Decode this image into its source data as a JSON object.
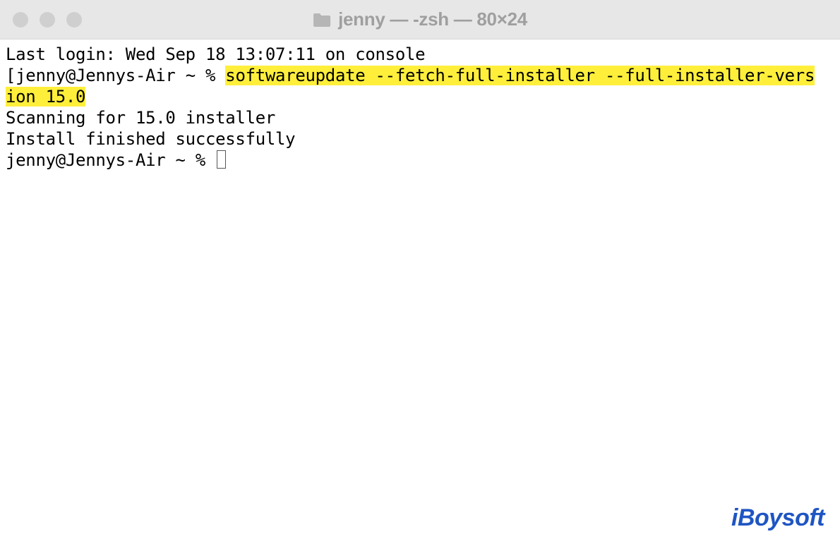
{
  "titlebar": {
    "title": "jenny — -zsh — 80×24"
  },
  "terminal": {
    "last_login": "Last login: Wed Sep 18 13:07:11 on console",
    "prompt_bracket": "[",
    "prompt1": "jenny@Jennys-Air ~ % ",
    "command_part1": "softwareupdate --fetch-full-installer --full-installer-vers",
    "command_part2": "ion 15.0",
    "output1": "Scanning for 15.0 installer",
    "output2": "Install finished successfully",
    "prompt2": "jenny@Jennys-Air ~ % "
  },
  "watermark": {
    "text": "iBoysoft"
  }
}
